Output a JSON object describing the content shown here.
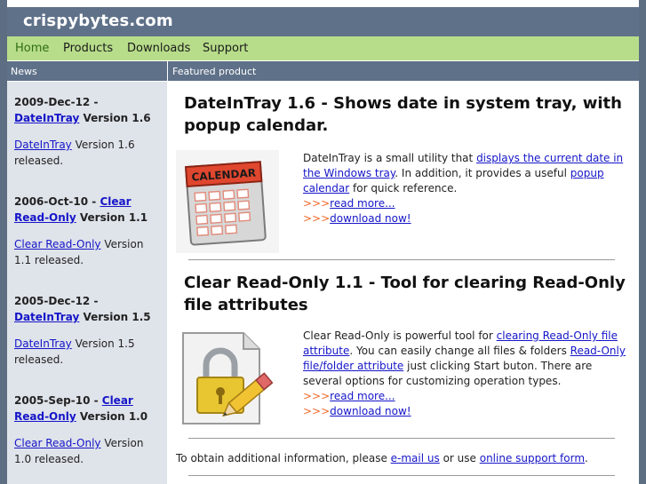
{
  "site": {
    "logo": "crispybytes.com"
  },
  "nav": {
    "items": [
      "Home",
      "Products",
      "Downloads",
      "Support"
    ]
  },
  "sidebar": {
    "heading": "News",
    "news": [
      {
        "date": "2009-Dec-12 - ",
        "product": "DateInTray",
        "version": " Version 1.6",
        "body_link": "DateInTray",
        "body_text": " Version 1.6 released."
      },
      {
        "date": "2006-Oct-10 - ",
        "product": "Clear Read-Only",
        "version": " Version 1.1",
        "body_link": "Clear Read-Only",
        "body_text": " Version 1.1 released."
      },
      {
        "date": "2005-Dec-12 - ",
        "product": "DateInTray",
        "version": " Version 1.5",
        "body_link": "DateInTray",
        "body_text": " Version 1.5 released."
      },
      {
        "date": "2005-Sep-10 - ",
        "product": "Clear Read-Only",
        "version": " Version 1.0",
        "body_link": "Clear Read-Only",
        "body_text": " Version 1.0 released."
      }
    ]
  },
  "main": {
    "heading": "Featured product",
    "products": [
      {
        "title": "DateInTray 1.6 - Shows date in system tray, with popup calendar.",
        "image_label": "CALENDAR",
        "desc": {
          "t1": "DateInTray is a small utility that ",
          "l1": "displays the current date in the Windows tray",
          "t2": ". In addition, it provides a useful ",
          "l2": "popup calendar",
          "t3": " for quick reference."
        },
        "arrow": ">>>",
        "read_more": "read more...",
        "download": "download now!"
      },
      {
        "title": "Clear Read-Only 1.1 - Tool for clearing Read-Only file attributes",
        "desc": {
          "t1": "Clear Read-Only is powerful tool for ",
          "l1": "clearing Read-Only file attribute",
          "t2": ". You can easily change all files & folders ",
          "l2": "Read-Only file/folder attribute",
          "t3": " just clicking Start buton. There are several options for customizing operation types."
        },
        "arrow": ">>>",
        "read_more": "read more...",
        "download": "download now!"
      }
    ],
    "footer": {
      "t1": "To obtain additional information, please ",
      "l1": "e-mail us",
      "t2": " or use ",
      "l2": "online support form",
      "t3": "."
    }
  },
  "colors": {
    "header": "#5f7189",
    "nav": "#b7dd8a",
    "sidebar": "#dfe3ea",
    "link": "#1515c8",
    "arrow": "#f06a2a"
  }
}
